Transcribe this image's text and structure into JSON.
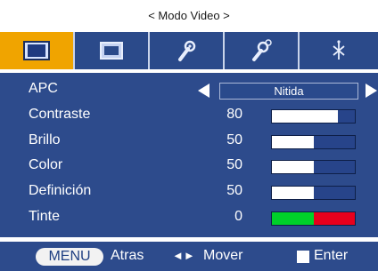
{
  "title": "< Modo Video >",
  "tabs": [
    {
      "icon": "picture-icon",
      "active": true
    },
    {
      "icon": "screen-icon",
      "active": false
    },
    {
      "icon": "wrench-icon",
      "active": false
    },
    {
      "icon": "wrench-gear-icon",
      "active": false
    },
    {
      "icon": "network-icon",
      "active": false
    }
  ],
  "apc": {
    "label": "APC",
    "value": "Nitida"
  },
  "settings": [
    {
      "label": "Contraste",
      "value": "80",
      "level": 0.8
    },
    {
      "label": "Brillo",
      "value": "50",
      "level": 0.5
    },
    {
      "label": "Color",
      "value": "50",
      "level": 0.5
    },
    {
      "label": "Definición",
      "value": "50",
      "level": 0.5
    }
  ],
  "tint": {
    "label": "Tinte",
    "value": "0",
    "colors": [
      "#00d02a",
      "#e8001c"
    ]
  },
  "footer": {
    "menu": "MENU",
    "back": "Atras",
    "arrows": "◄►",
    "move": "Mover",
    "enter": "Enter"
  },
  "colors": {
    "accent": "#f0a400",
    "panel": "#2d4b8c"
  }
}
